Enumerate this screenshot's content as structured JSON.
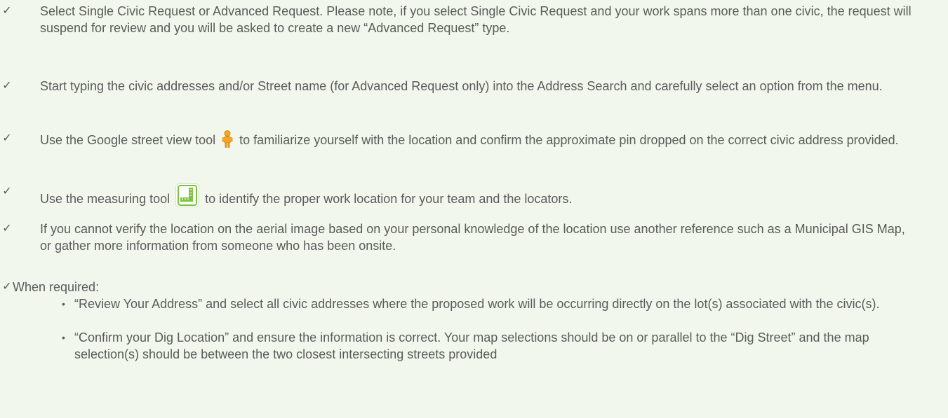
{
  "items": [
    {
      "check": "✓",
      "text": "Select Single Civic Request or Advanced Request. Please note, if you select Single Civic Request and your work spans more than one civic, the request will suspend for review and you will be asked to create a new “Advanced Request” type."
    },
    {
      "check": "✓",
      "text": "Start typing the civic addresses and/or Street name (for Advanced Request only) into the Address Search and carefully select an option from the menu."
    },
    {
      "check": "✓",
      "text_before": "Use the Google street view tool",
      "icon": "pegman-icon",
      "text_after": "to familiarize yourself with the location and confirm the approximate pin dropped on the correct civic address provided."
    },
    {
      "check": "✓",
      "text_before": "Use the measuring tool",
      "icon": "ruler-icon",
      "text_after": "to identify the proper work location for your team and the locators."
    },
    {
      "check": "✓",
      "text": "If you cannot verify the location on the aerial image based on your personal knowledge of the location use another reference such as a Municipal GIS Map, or gather more information from someone who has been onsite."
    }
  ],
  "when_required": {
    "check": "✓",
    "label": "When required:",
    "bullet": "•",
    "subitems": [
      "“Review Your Address” and select all civic addresses where the proposed work will be occurring directly on the lot(s) associated with the civic(s).",
      " “Confirm your Dig Location” and ensure the information is correct. Your map selections should be on or parallel to the “Dig Street” and the map selection(s) should be between the two closest intersecting streets provided"
    ]
  },
  "colors": {
    "background": "#f1f7ec",
    "text": "#5b5b5b",
    "pegman": "#f5a623",
    "ruler": "#7dc242"
  }
}
